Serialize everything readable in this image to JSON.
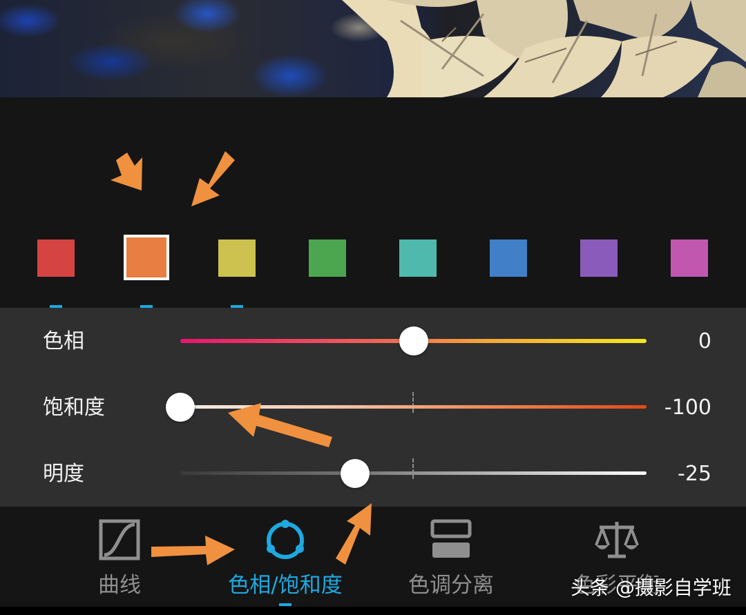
{
  "swatches": [
    {
      "name": "red",
      "color": "#d54343"
    },
    {
      "name": "orange",
      "color": "#e97e42",
      "selected": true
    },
    {
      "name": "yellow",
      "color": "#cdc14f"
    },
    {
      "name": "green",
      "color": "#4ca64f"
    },
    {
      "name": "aqua",
      "color": "#4fb9ae"
    },
    {
      "name": "blue",
      "color": "#4180c8"
    },
    {
      "name": "purple",
      "color": "#8b5bbb"
    },
    {
      "name": "magenta",
      "color": "#c257b0"
    }
  ],
  "sliders": {
    "hue": {
      "label": "色相",
      "value": "0",
      "level": 0
    },
    "saturation": {
      "label": "饱和度",
      "value": "-100",
      "level": -100
    },
    "luminance": {
      "label": "明度",
      "value": "-25",
      "level": -25
    }
  },
  "nav": {
    "curves": {
      "label": "曲线",
      "icon": "curve-icon"
    },
    "hsl": {
      "label": "色相/饱和度",
      "icon": "hsl-ring-icon",
      "active": true
    },
    "split_toning": {
      "label": "色调分离",
      "icon": "split-tone-icon"
    },
    "balance": {
      "label": "色彩平衡",
      "icon": "balance-scale-icon"
    }
  },
  "watermark": "头条 @摄影自学班",
  "colors": {
    "accent": "#1ea9e0",
    "annotation_arrow": "#f0913f"
  }
}
